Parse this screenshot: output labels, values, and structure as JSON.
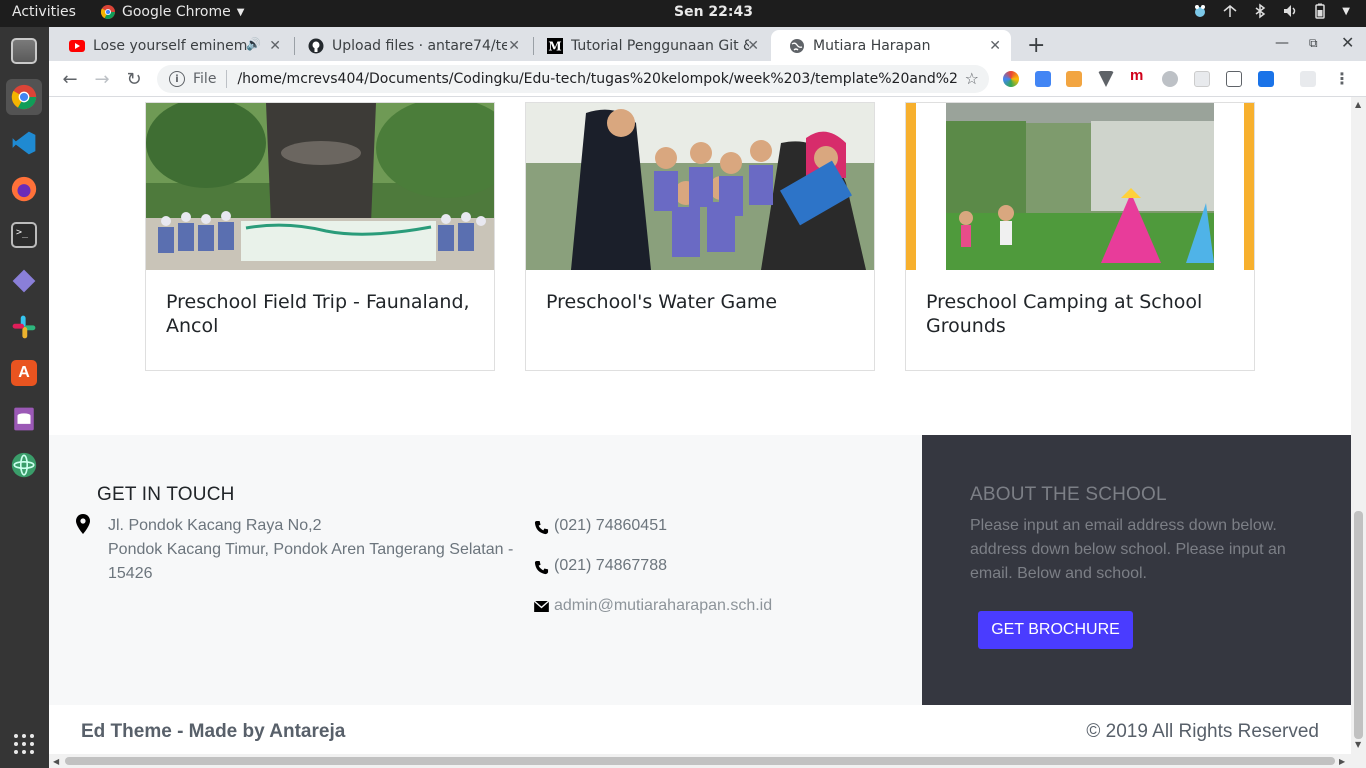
{
  "topbar": {
    "activities": "Activities",
    "app_name": "Google Chrome",
    "clock": "Sen 22:43"
  },
  "dock": {
    "items": [
      "files-icon",
      "chrome-icon",
      "vscode-icon",
      "firefox-icon",
      "terminal-icon",
      "git-client-icon",
      "slack-icon",
      "software-center-icon",
      "db-browser-icon",
      "atom-icon"
    ]
  },
  "browser": {
    "tabs": [
      {
        "title": "Lose yourself eminem",
        "icon": "youtube-icon"
      },
      {
        "title": "Upload files · antare74/te",
        "icon": "github-icon"
      },
      {
        "title": "Tutorial Penggunaan Git &",
        "icon": "medium-icon"
      },
      {
        "title": "Mutiara Harapan",
        "icon": "globe-icon"
      }
    ],
    "omnibox": {
      "scheme": "File",
      "url": "/home/mcrevs404/Documents/Codingku/Edu-tech/tugas%20kelompok/week%203/template%20and%20form/..."
    }
  },
  "page": {
    "cards": [
      {
        "caption": "Preschool Field Trip - Faunaland, Ancol"
      },
      {
        "caption": "Preschool's Water Game"
      },
      {
        "caption": "Preschool Camping at School Grounds"
      }
    ],
    "contact": {
      "heading": "GET IN TOUCH",
      "address_line1": "Jl. Pondok Kacang Raya No,2",
      "address_line2": "Pondok Kacang Timur, Pondok Aren Tangerang Selatan - 15426",
      "phone1": "(021) 74860451",
      "phone2": "(021) 74867788",
      "email": "admin@mutiaraharapan.sch.id"
    },
    "about": {
      "heading": "ABOUT THE SCHOOL",
      "text": "Please input an email address down below. address down below school. Please input an email. Below and school.",
      "button": "GET BROCHURE"
    },
    "bottom": {
      "credit": "Ed Theme - Made by Antareja",
      "copyright": "© 2019 All Rights Reserved"
    }
  },
  "colors": {
    "accent_button": "#4a3cff",
    "dark_panel": "#353740",
    "light_panel": "#f7f8f9"
  }
}
